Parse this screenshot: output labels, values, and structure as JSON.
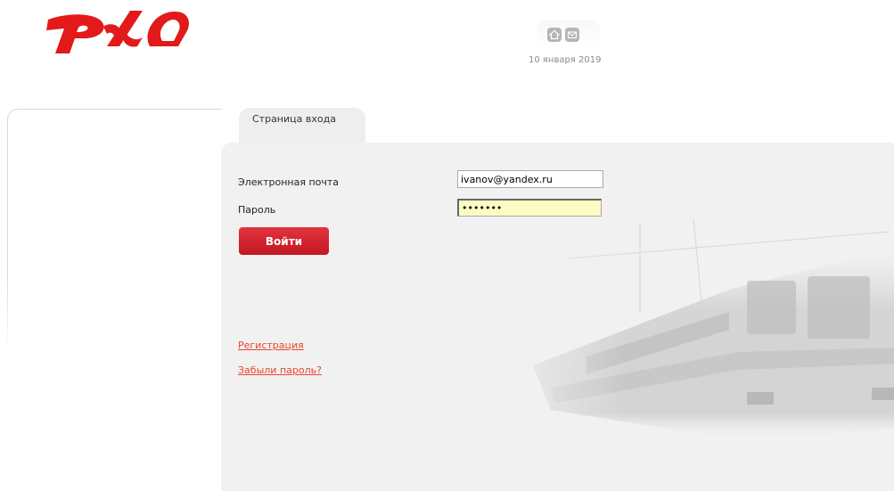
{
  "header": {
    "logo_icon": "rzd-logo",
    "logo_color": "#e21a1a",
    "home_icon": "home-icon",
    "mail_icon": "mail-icon",
    "date": "10 января 2019"
  },
  "tab": {
    "label": "Страница входа"
  },
  "form": {
    "email_label": "Электронная почта",
    "email_value": "ivanov@yandex.ru",
    "password_label": "Пароль",
    "password_value": "•••••••",
    "login_button": "Войти",
    "button_color": "#d01f2b"
  },
  "links": {
    "register": "Регистрация",
    "forgot_password": "Забыли пароль?",
    "link_color": "#e8462a"
  },
  "decor": {
    "background_image": "train-illustration"
  }
}
